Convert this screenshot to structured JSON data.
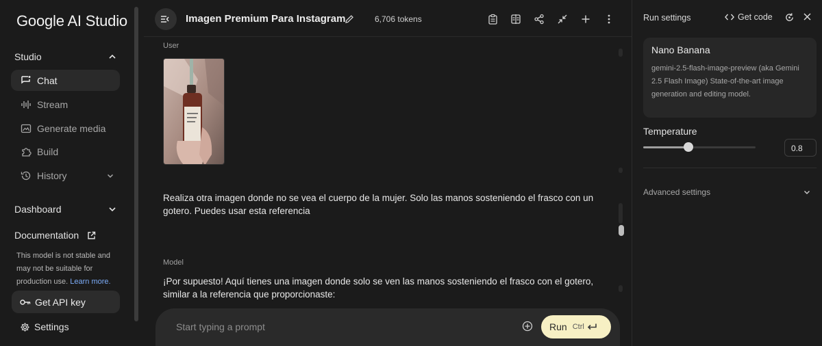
{
  "sidebar": {
    "logo": "Google AI Studio",
    "studio_label": "Studio",
    "items": [
      {
        "label": "Chat",
        "icon": "chat-icon"
      },
      {
        "label": "Stream",
        "icon": "stream-icon"
      },
      {
        "label": "Generate media",
        "icon": "media-icon"
      },
      {
        "label": "Build",
        "icon": "build-icon"
      },
      {
        "label": "History",
        "icon": "history-icon"
      }
    ],
    "dashboard_label": "Dashboard",
    "documentation_label": "Documentation",
    "notice_text": "This model is not stable and may not be suitable for production use.",
    "learn_more": "Learn more.",
    "api_key_label": "Get API key",
    "settings_label": "Settings"
  },
  "topbar": {
    "title": "Imagen Premium Para Instagram",
    "tokens": "6,706 tokens"
  },
  "chat": {
    "user_role": "User",
    "user_message": "Realiza otra imagen donde no se vea el cuerpo de la mujer. Solo las manos sosteniendo el frasco con un gotero. Puedes usar esta referencia",
    "model_role": "Model",
    "model_message": "¡Por supuesto! Aquí tienes una imagen donde solo se ven las manos sosteniendo el frasco con el gotero, similar a la referencia que proporcionaste:"
  },
  "prompt": {
    "placeholder": "Start typing a prompt",
    "run_label": "Run",
    "shortcut": "Ctrl"
  },
  "run_settings": {
    "title": "Run settings",
    "get_code": "Get code",
    "model_name": "Nano Banana",
    "model_description": "gemini-2.5-flash-image-preview (aka Gemini 2.5 Flash Image) State-of-the-art image generation and editing model.",
    "temperature_label": "Temperature",
    "temperature_value": "0.8",
    "temperature_max": 2,
    "advanced_label": "Advanced settings"
  },
  "colors": {
    "accent_run": "#f7f0c4",
    "link": "#7cacf8",
    "background": "#1b1b1b"
  }
}
